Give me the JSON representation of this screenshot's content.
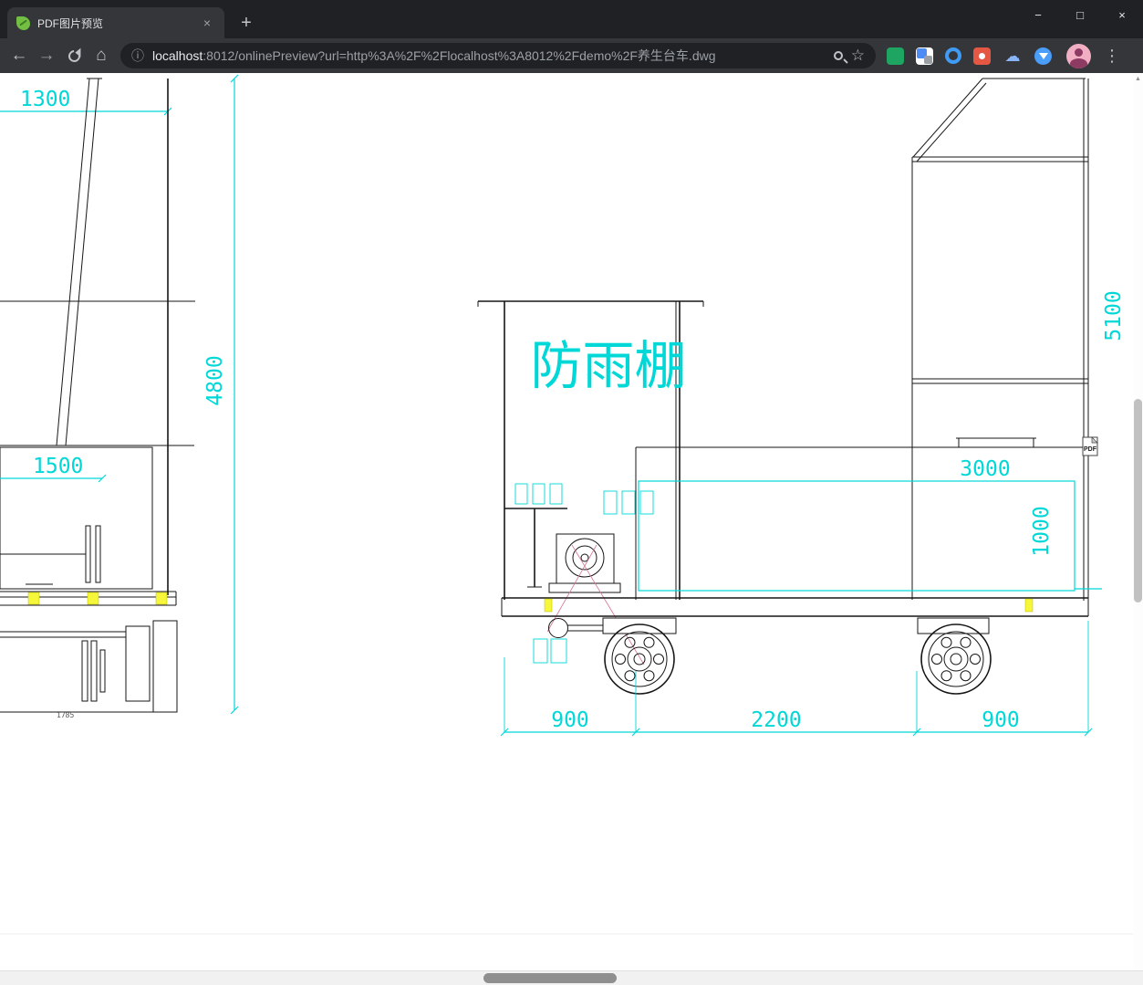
{
  "tabbar": {
    "tab_title": "PDF图片预览"
  },
  "icons": {
    "close_tab": "×",
    "new_tab": "+",
    "minimize": "−",
    "maximize": "□",
    "close_window": "×",
    "back": "←",
    "forward": "→",
    "home": "⌂",
    "info": "ⓘ",
    "star": "☆",
    "cloud": "☁",
    "menu": "⋮",
    "scroll_up": "▲"
  },
  "navbar": {
    "url_host": "localhost",
    "url_rest": ":8012/onlinePreview?url=http%3A%2F%2Flocalhost%3A8012%2Fdemo%2F养生台车.dwg"
  },
  "drawing": {
    "shelter_label": "防雨棚",
    "dims": {
      "d1300": "1300",
      "d4800": "4800",
      "d1500": "1500",
      "d1785": "1785",
      "d5100": "5100",
      "d3000": "3000",
      "d1000": "1000",
      "d900l": "900",
      "d2200": "2200",
      "d900r": "900"
    },
    "pdf_badge": "PDF",
    "colors": {
      "dim": "#00d8d8",
      "line": "#161616",
      "hl": "#f6f63a",
      "cl": "#d4748c"
    }
  }
}
